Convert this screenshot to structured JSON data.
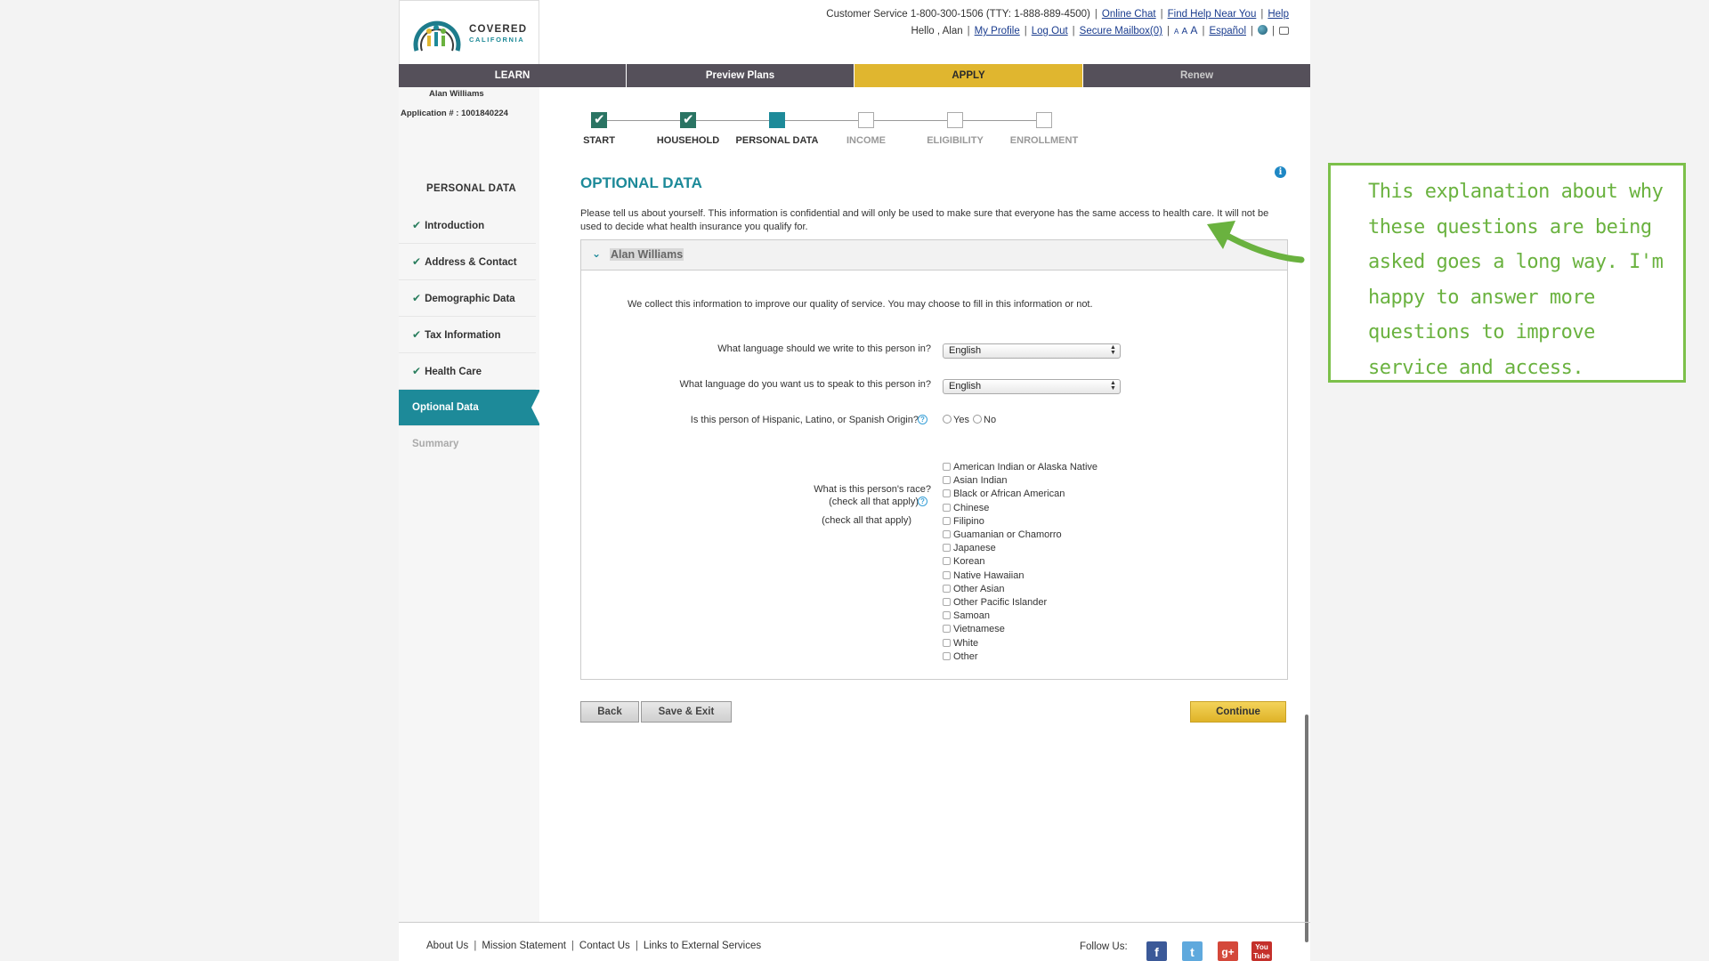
{
  "brand": {
    "line1": "COVERED",
    "line2": "CALIFORNIA"
  },
  "utility": {
    "customer_service": "Customer Service 1-800-300-1506 (TTY: 1-888-889-4500)",
    "online_chat": "Online Chat",
    "find_help": "Find Help Near You",
    "help": "Help",
    "greeting": "Hello , Alan",
    "my_profile": "My Profile",
    "log_out": "Log Out",
    "secure_mailbox": "Secure Mailbox(0)",
    "text_sizes": [
      "A",
      "A",
      "A"
    ],
    "espanol": "Español",
    "icons": [
      "globe-icon",
      "printer-icon"
    ]
  },
  "nav": {
    "learn": "LEARN",
    "preview": "Preview Plans",
    "apply": "APPLY",
    "renew": "Renew"
  },
  "account": {
    "name": "Alan Williams",
    "application": "Application # : 1001840224"
  },
  "sidebar": {
    "title": "PERSONAL DATA",
    "items": [
      {
        "label": "Introduction",
        "state": "done"
      },
      {
        "label": "Address & Contact",
        "state": "done"
      },
      {
        "label": "Demographic Data",
        "state": "done"
      },
      {
        "label": "Tax Information",
        "state": "done"
      },
      {
        "label": "Health Care",
        "state": "done"
      },
      {
        "label": "Optional Data",
        "state": "active"
      },
      {
        "label": "Summary",
        "state": "disabled"
      }
    ]
  },
  "progress": {
    "steps": [
      {
        "label": "START",
        "state": "done"
      },
      {
        "label": "HOUSEHOLD",
        "state": "done"
      },
      {
        "label": "PERSONAL DATA",
        "state": "current"
      },
      {
        "label": "INCOME",
        "state": "future"
      },
      {
        "label": "ELIGIBILITY",
        "state": "future"
      },
      {
        "label": "ENROLLMENT",
        "state": "future"
      }
    ]
  },
  "main": {
    "title": "OPTIONAL DATA",
    "intro": "Please tell us about yourself. This information is confidential and will only be used to make sure that everyone has the same access to health care. It will not be used to decide what health insurance you qualify for.",
    "person": "Alan  Williams",
    "collect_note": "We collect this information to improve our quality of service. You may choose to fill in this information or not.",
    "q_write": "What language should we write to this person in?",
    "write_value": "English",
    "q_speak": "What language do you want us to speak to this person in?",
    "speak_value": "English",
    "q_hispanic": "Is this person of Hispanic, Latino, or Spanish Origin?",
    "yes": "Yes",
    "no": "No",
    "q_race": "What is this person's race?",
    "q_race_sub": "(check all that apply)",
    "q_race_sub2": "(check all that apply)",
    "races": [
      "American Indian or Alaska Native",
      "Asian Indian",
      "Black or African American",
      "Chinese",
      "Filipino",
      "Guamanian or Chamorro",
      "Japanese",
      "Korean",
      "Native Hawaiian",
      "Other Asian",
      "Other Pacific Islander",
      "Samoan",
      "Vietnamese",
      "White",
      "Other"
    ]
  },
  "buttons": {
    "back": "Back",
    "save_exit": "Save & Exit",
    "continue": "Continue"
  },
  "footer": {
    "links": [
      "About Us",
      "Mission Statement",
      "Contact Us",
      "Links to External Services"
    ],
    "follow": "Follow Us:",
    "social": [
      {
        "icon": "facebook-icon",
        "glyph": "f"
      },
      {
        "icon": "twitter-icon",
        "glyph": "t"
      },
      {
        "icon": "google-plus-icon",
        "glyph": "g+"
      },
      {
        "icon": "youtube-icon",
        "glyph": "You Tube"
      }
    ]
  },
  "annotation": {
    "text": "This explanation about why these questions are being asked goes a long way. I'm happy to answer more questions to improve service and access.",
    "color": "#6ab23f"
  }
}
